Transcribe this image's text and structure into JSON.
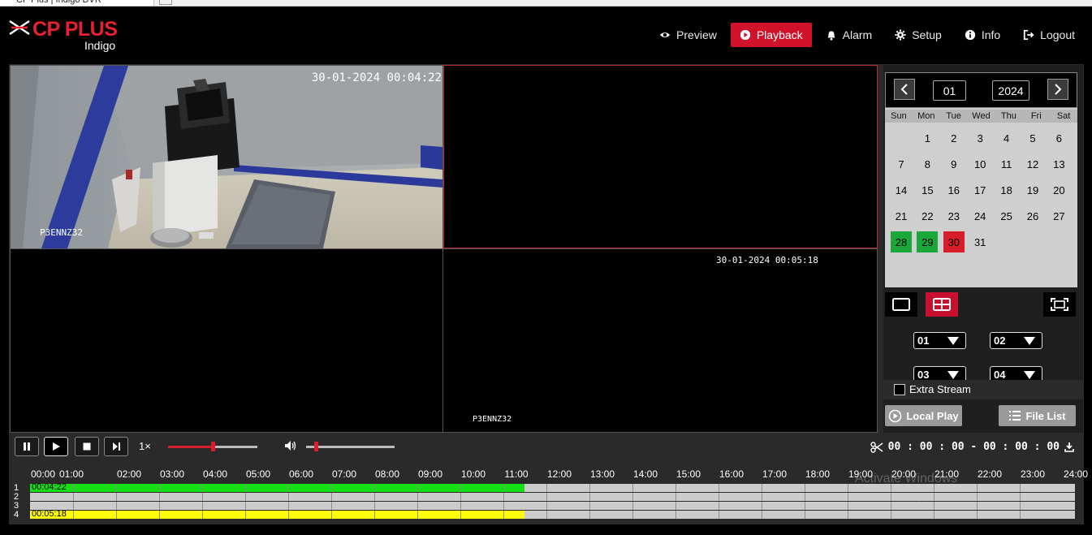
{
  "browser": {
    "tab_title": "CP Plus | Indigo DVR"
  },
  "header": {
    "brand": "CP PLUS",
    "brand_sub": "Indigo",
    "brand_color": "#e8212f",
    "nav": [
      {
        "label": "Preview",
        "icon": "eye-icon"
      },
      {
        "label": "Playback",
        "icon": "play-circle-icon",
        "active": true
      },
      {
        "label": "Alarm",
        "icon": "bell-icon"
      },
      {
        "label": "Setup",
        "icon": "gear-icon"
      },
      {
        "label": "Info",
        "icon": "info-icon"
      },
      {
        "label": "Logout",
        "icon": "logout-icon"
      }
    ]
  },
  "video": {
    "cells": [
      {
        "timestamp": "30-01-2024 00:04:22",
        "camera": "P3ENNZ32",
        "selected": false,
        "has_image": true
      },
      {
        "timestamp": "",
        "camera": "",
        "selected": true,
        "has_image": false
      },
      {
        "timestamp": "",
        "camera": "",
        "selected": false,
        "has_image": false
      },
      {
        "timestamp": "30-01-2024 00:05:18",
        "camera": "P3ENNZ32",
        "selected": false,
        "has_image": false
      }
    ]
  },
  "calendar": {
    "month": "01",
    "year": "2024",
    "weekdays": [
      "Sun",
      "Mon",
      "Tue",
      "Wed",
      "Thu",
      "Fri",
      "Sat"
    ],
    "first_weekday_index": 1,
    "days_in_month": 31,
    "recorded_days": [
      28,
      29
    ],
    "selected_day": 30,
    "colors": {
      "recorded": "#1aa83a",
      "selected": "#d81e2a"
    }
  },
  "channels": {
    "selects": [
      "01",
      "02",
      "03",
      "04"
    ]
  },
  "extra_stream": {
    "label": "Extra Stream",
    "checked": false
  },
  "buttons": {
    "local_play": "Local Play",
    "file_list": "File List"
  },
  "playback": {
    "speed": "1×",
    "progress": 0.5,
    "volume": 0.0,
    "clip_time": "00 : 00 : 00 - 00 : 00 : 00"
  },
  "timeline": {
    "hours": [
      "00:00",
      "01:00",
      "02:00",
      "03:00",
      "04:00",
      "05:00",
      "06:00",
      "07:00",
      "08:00",
      "09:00",
      "10:00",
      "11:00",
      "12:00",
      "13:00",
      "14:00",
      "15:00",
      "16:00",
      "17:00",
      "18:00",
      "19:00",
      "20:00",
      "21:00",
      "22:00",
      "23:00",
      "24:00"
    ],
    "tracks": [
      {
        "num": "1",
        "label": "00:04:22",
        "recorded_until_hour": 11.35,
        "color": "#14e014"
      },
      {
        "num": "2",
        "label": "",
        "recorded_until_hour": 0,
        "color": ""
      },
      {
        "num": "3",
        "label": "",
        "recorded_until_hour": 0,
        "color": ""
      },
      {
        "num": "4",
        "label": "00:05:18",
        "recorded_until_hour": 11.35,
        "color": "#ffff00"
      }
    ]
  },
  "watermark": {
    "line1": "Activate Windows",
    "line2": "Go to Settings to activate Windows."
  }
}
